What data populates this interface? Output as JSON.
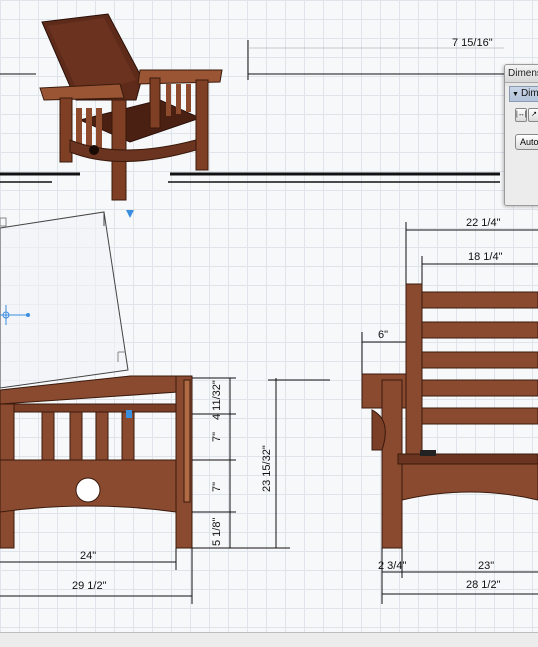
{
  "panel": {
    "title": "Dimens",
    "section": "Dim",
    "auto_button": "Auto"
  },
  "dimensions": {
    "top_overall": "7 15/16\"",
    "right_depth_22": "22 1/4\"",
    "right_depth_18": "18 1/4\"",
    "right_arm_6": "6\"",
    "seg_4_11_32": "4 11/32\"",
    "seg_7a": "7\"",
    "seg_7b": "7\"",
    "seg_5_1_8": "5 1/8\"",
    "height_total": "23 15/32\"",
    "front_inner_24": "24\"",
    "front_outer_29": "29 1/2\"",
    "side_2_3_4": "2 3/4\"",
    "side_23": "23\"",
    "side_28": "28 1/2\""
  },
  "colors": {
    "wood": "#8a4a30",
    "wood_dark": "#5a2a18",
    "wood_light": "#a8603e",
    "selection_blue": "#3a8ee0"
  }
}
